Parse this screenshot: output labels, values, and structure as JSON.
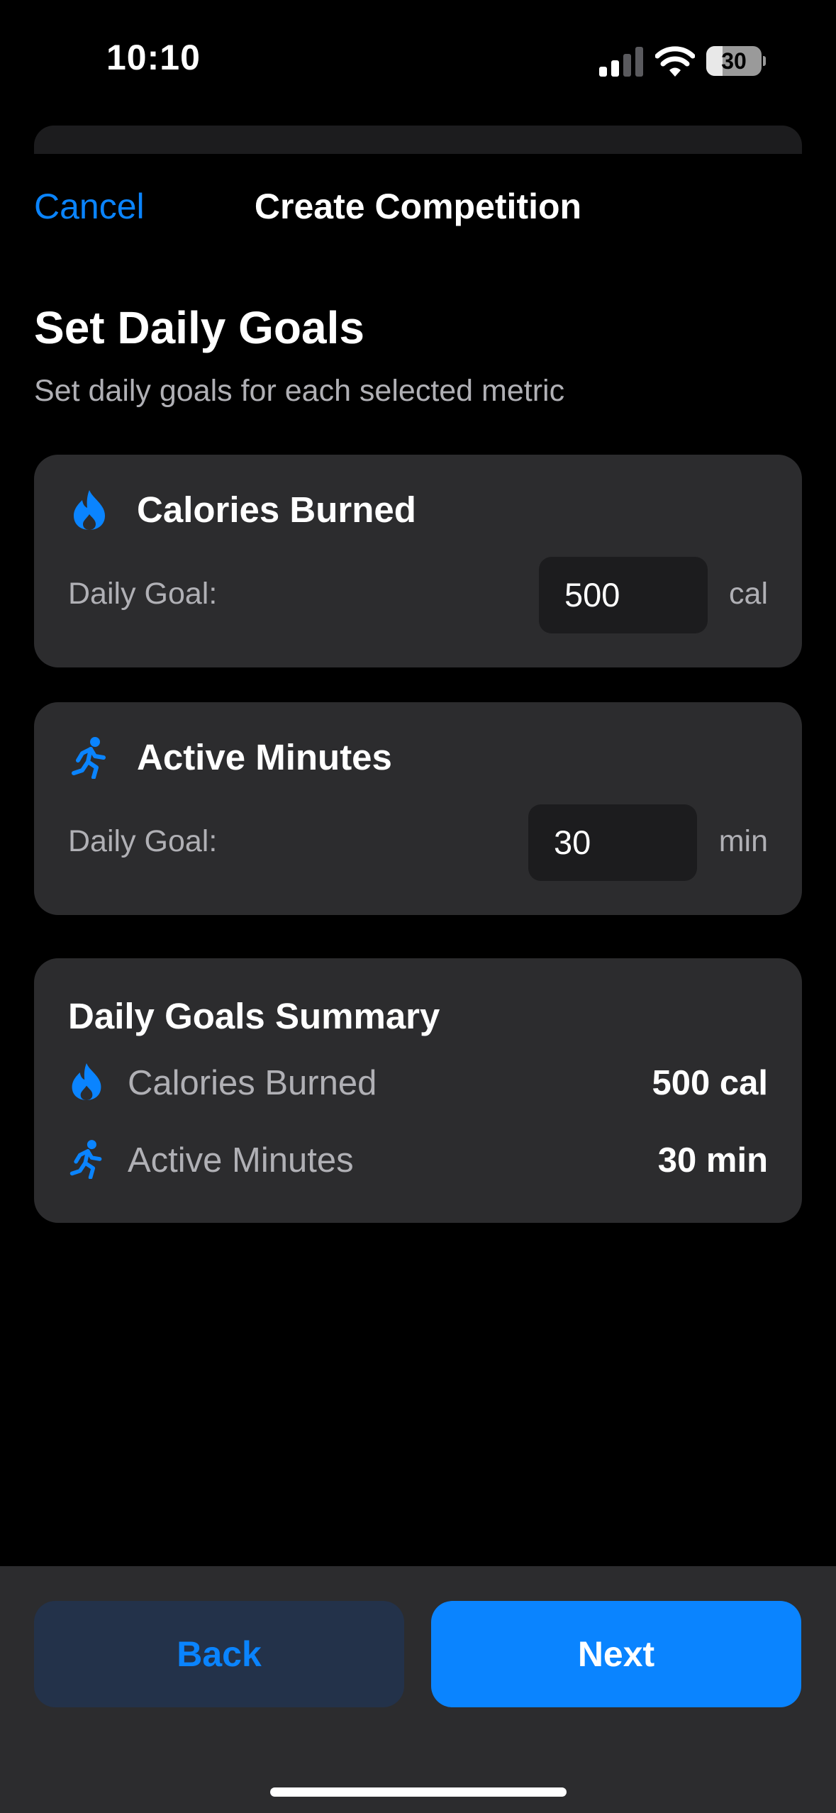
{
  "status_bar": {
    "time": "10:10",
    "battery_level": "30"
  },
  "nav": {
    "cancel_label": "Cancel",
    "title": "Create Competition"
  },
  "heading": "Set Daily Goals",
  "subtitle": "Set daily goals for each selected metric",
  "metrics": [
    {
      "icon": "flame-icon",
      "title": "Calories Burned",
      "goal_label": "Daily Goal:",
      "goal_value": "500",
      "unit": "cal"
    },
    {
      "icon": "running-figure-icon",
      "title": "Active Minutes",
      "goal_label": "Daily Goal:",
      "goal_value": "30",
      "unit": "min"
    }
  ],
  "summary": {
    "title": "Daily Goals Summary",
    "rows": [
      {
        "icon": "flame-icon",
        "label": "Calories Burned",
        "value": "500 cal"
      },
      {
        "icon": "running-figure-icon",
        "label": "Active Minutes",
        "value": "30 min"
      }
    ]
  },
  "footer": {
    "back_label": "Back",
    "next_label": "Next"
  },
  "colors": {
    "accent": "#0a84ff",
    "card_background": "#2c2c2e",
    "input_background": "#1c1c1e",
    "back_button_background": "#23324a"
  }
}
